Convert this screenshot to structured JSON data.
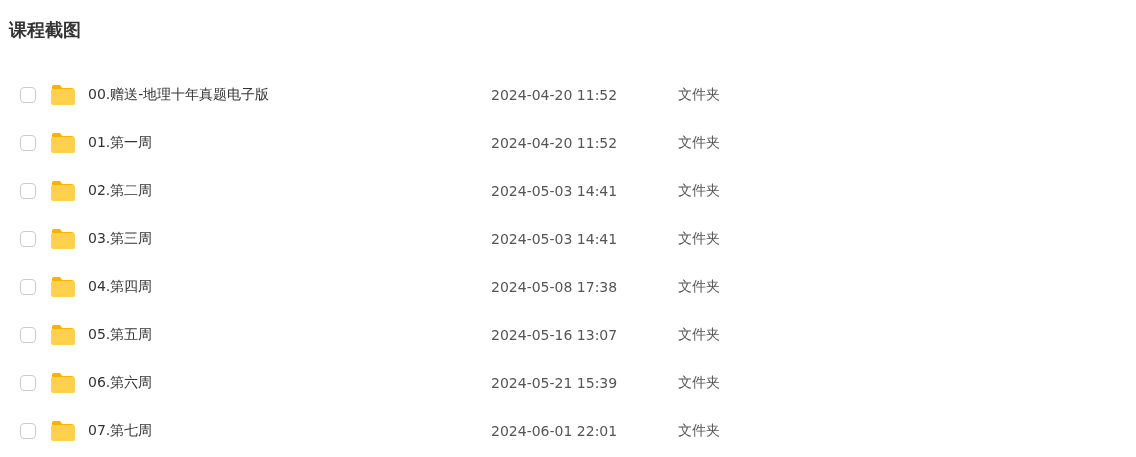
{
  "title": "课程截图",
  "files": [
    {
      "name": "00.赠送-地理十年真题电子版",
      "modified": "2024-04-20 11:52",
      "type": "文件夹",
      "checked": false
    },
    {
      "name": "01.第一周",
      "modified": "2024-04-20 11:52",
      "type": "文件夹",
      "checked": false
    },
    {
      "name": "02.第二周",
      "modified": "2024-05-03 14:41",
      "type": "文件夹",
      "checked": false
    },
    {
      "name": "03.第三周",
      "modified": "2024-05-03 14:41",
      "type": "文件夹",
      "checked": false
    },
    {
      "name": "04.第四周",
      "modified": "2024-05-08 17:38",
      "type": "文件夹",
      "checked": false
    },
    {
      "name": "05.第五周",
      "modified": "2024-05-16 13:07",
      "type": "文件夹",
      "checked": false
    },
    {
      "name": "06.第六周",
      "modified": "2024-05-21 15:39",
      "type": "文件夹",
      "checked": false
    },
    {
      "name": "07.第七周",
      "modified": "2024-06-01 22:01",
      "type": "文件夹",
      "checked": false
    }
  ]
}
